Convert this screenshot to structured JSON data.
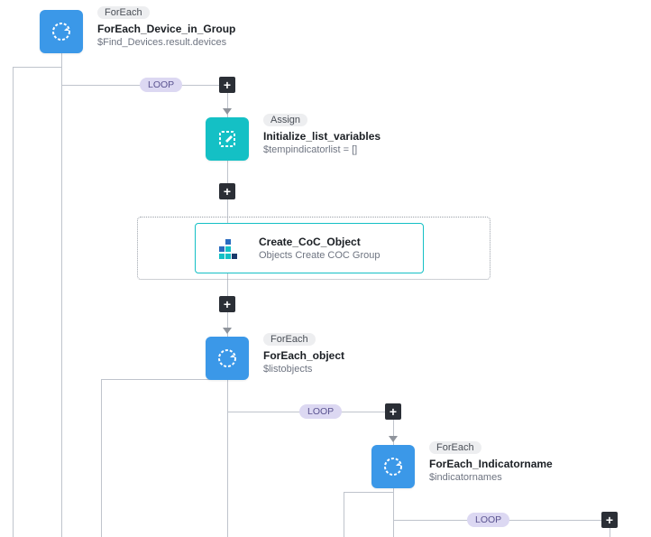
{
  "nodes": {
    "foreach_device": {
      "type": "ForEach",
      "title": "ForEach_Device_in_Group",
      "subtitle": "$Find_Devices.result.devices"
    },
    "initialize": {
      "type": "Assign",
      "title": "Initialize_list_variables",
      "subtitle": "$tempindicatorlist = []"
    },
    "create_coc": {
      "title": "Create_CoC_Object",
      "subtitle": "Objects Create COC Group"
    },
    "foreach_object": {
      "type": "ForEach",
      "title": "ForEach_object",
      "subtitle": "$listobjects"
    },
    "foreach_indicator": {
      "type": "ForEach",
      "title": "ForEach_Indicatorname",
      "subtitle": "$indicatornames"
    }
  },
  "badges": {
    "loop": "LOOP"
  }
}
